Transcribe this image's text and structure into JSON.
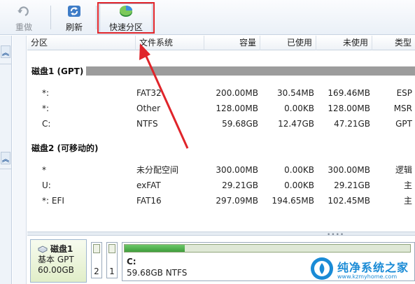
{
  "toolbar": {
    "redo_label": "重做",
    "refresh_label": "刷新",
    "quick_partition_label": "快速分区"
  },
  "table": {
    "headers": {
      "partition": "分区",
      "filesystem": "文件系统",
      "capacity": "容量",
      "used": "已使用",
      "free": "未使用",
      "type": "类型"
    },
    "disks": [
      {
        "title": "磁盘1 (GPT)",
        "rows": [
          {
            "partition": "*:",
            "filesystem": "FAT32",
            "capacity": "200.00MB",
            "used": "30.54MB",
            "free": "169.46MB",
            "type": "ESP"
          },
          {
            "partition": "*:",
            "filesystem": "Other",
            "capacity": "128.00MB",
            "used": "0.00KB",
            "free": "128.00MB",
            "type": "MSR"
          },
          {
            "partition": "C:",
            "filesystem": "NTFS",
            "capacity": "59.68GB",
            "used": "12.47GB",
            "free": "47.21GB",
            "type": "GPT"
          }
        ]
      },
      {
        "title": "磁盘2 (可移动的)",
        "rows": [
          {
            "partition": "*",
            "filesystem": "未分配空间",
            "capacity": "300.00MB",
            "used": "0.00KB",
            "free": "300.00MB",
            "type": "逻辑"
          },
          {
            "partition": "U:",
            "filesystem": "exFAT",
            "capacity": "29.21GB",
            "used": "0.00KB",
            "free": "29.21GB",
            "type": "主"
          },
          {
            "partition": "*: EFI",
            "filesystem": "FAT16",
            "capacity": "297.09MB",
            "used": "194.65MB",
            "free": "102.45MB",
            "type": "主"
          }
        ]
      }
    ]
  },
  "diskmap": {
    "disk_name": "磁盘1",
    "disk_style": "基本 GPT",
    "disk_size": "60.00GB",
    "mini_partitions": [
      "2",
      "1"
    ],
    "main_partition": {
      "label": "C:",
      "detail": "59.68GB NTFS",
      "used_fraction": 0.21
    }
  },
  "watermark": {
    "title": "纯净系统之家",
    "url": "www.kzmyhome.com"
  },
  "colors": {
    "annotation_red": "#e0242a",
    "usage_green": "#4caf50"
  }
}
